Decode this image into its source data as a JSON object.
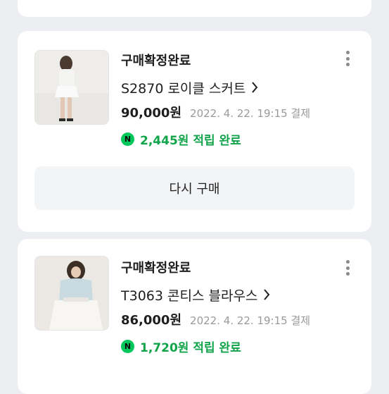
{
  "orders": [
    {
      "status": "구매확정완료",
      "product": "S2870 로이클 스커트",
      "price": "90,000원",
      "date": "2022. 4. 22. 19:15 결제",
      "points": "2,445원 적립 완료",
      "points_icon": "N",
      "rebuy_label": "다시 구매"
    },
    {
      "status": "구매확정완료",
      "product": "T3063 콘티스 블라우스",
      "price": "86,000원",
      "date": "2022. 4. 22. 19:15 결제",
      "points": "1,720원 적립 완료",
      "points_icon": "N"
    }
  ],
  "colors": {
    "background": "#eceef2",
    "card": "#ffffff",
    "points_green": "#12a44b",
    "npay_green": "#03c75a",
    "date_gray": "#9a9a9a"
  }
}
